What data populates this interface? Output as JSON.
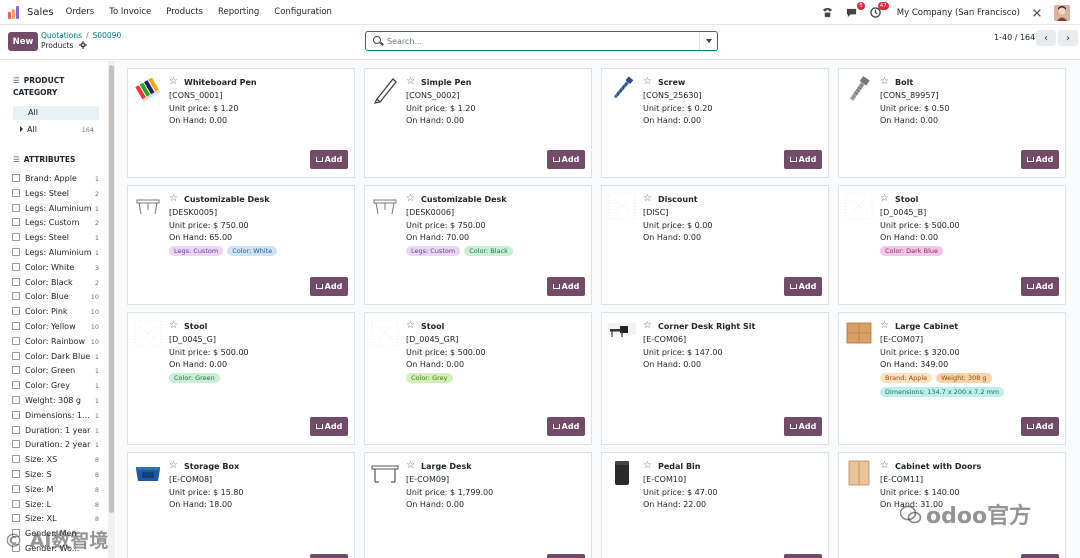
{
  "navbar": {
    "app_name": "Sales",
    "menu": [
      "Orders",
      "To Invoice",
      "Products",
      "Reporting",
      "Configuration"
    ],
    "chat_badge": "5",
    "activity_badge": "47",
    "company": "My Company (San Francisco)"
  },
  "control": {
    "new_label": "New",
    "breadcrumb_parent": "Quotations",
    "breadcrumb_sep": "/",
    "breadcrumb_record": "S00090",
    "breadcrumb_current": "Products",
    "search_placeholder": "Search...",
    "pager": "1-40 / 164",
    "prev_icon": "‹",
    "next_icon": "›"
  },
  "sidebar": {
    "category_title_1": "PRODUCT",
    "category_title_2": "CATEGORY",
    "category_selected": "All",
    "category_row": {
      "label": "All",
      "count": "164"
    },
    "attributes_title": "ATTRIBUTES",
    "attributes": [
      {
        "label": "Brand: Apple",
        "count": "1"
      },
      {
        "label": "Legs: Steel",
        "count": "2"
      },
      {
        "label": "Legs: Aluminium",
        "count": "1"
      },
      {
        "label": "Legs: Custom",
        "count": "2"
      },
      {
        "label": "Legs: Steel",
        "count": "1"
      },
      {
        "label": "Legs: Aluminium",
        "count": "1"
      },
      {
        "label": "Color: White",
        "count": "3"
      },
      {
        "label": "Color: Black",
        "count": "2"
      },
      {
        "label": "Color: Blue",
        "count": "10"
      },
      {
        "label": "Color: Pink",
        "count": "10"
      },
      {
        "label": "Color: Yellow",
        "count": "10"
      },
      {
        "label": "Color: Rainbow",
        "count": "10"
      },
      {
        "label": "Color: Dark Blue",
        "count": "1"
      },
      {
        "label": "Color: Green",
        "count": "1"
      },
      {
        "label": "Color: Grey",
        "count": "1"
      },
      {
        "label": "Weight: 308 g",
        "count": "1"
      },
      {
        "label": "Dimensions: 1...",
        "count": "1"
      },
      {
        "label": "Duration: 1 year",
        "count": "1"
      },
      {
        "label": "Duration: 2 year",
        "count": "1"
      },
      {
        "label": "Size: XS",
        "count": "8"
      },
      {
        "label": "Size: S",
        "count": "8"
      },
      {
        "label": "Size: M",
        "count": "8"
      },
      {
        "label": "Size: L",
        "count": "8"
      },
      {
        "label": "Size: XL",
        "count": "8"
      },
      {
        "label": "Gender: Men",
        "count": ""
      },
      {
        "label": "Gender: Wo...",
        "count": ""
      }
    ]
  },
  "add_label": "Add",
  "products": [
    {
      "name": "Whiteboard Pen",
      "ref": "[CONS_0001]",
      "price": "Unit price: $ 1.20",
      "onhand": "On Hand: 0.00",
      "tags": []
    },
    {
      "name": "Simple Pen",
      "ref": "[CONS_0002]",
      "price": "Unit price: $ 1.20",
      "onhand": "On Hand: 0.00",
      "tags": []
    },
    {
      "name": "Screw",
      "ref": "[CONS_25630]",
      "price": "Unit price: $ 0.20",
      "onhand": "On Hand: 0.00",
      "tags": []
    },
    {
      "name": "Bolt",
      "ref": "[CONS_89957]",
      "price": "Unit price: $ 0.50",
      "onhand": "On Hand: 0.00",
      "tags": []
    },
    {
      "name": "Customizable Desk",
      "ref": "[DESK0005]",
      "price": "Unit price: $ 750.00",
      "onhand": "On Hand: 65.00",
      "tags": [
        {
          "label": "Legs: Custom",
          "bg": "#e9d6f5",
          "fg": "#6b3a8a"
        },
        {
          "label": "Color: White",
          "bg": "#cfe3f7",
          "fg": "#2a5d8f"
        }
      ]
    },
    {
      "name": "Customizable Desk",
      "ref": "[DESK0006]",
      "price": "Unit price: $ 750.00",
      "onhand": "On Hand: 70.00",
      "tags": [
        {
          "label": "Legs: Custom",
          "bg": "#e9d6f5",
          "fg": "#6b3a8a"
        },
        {
          "label": "Color: Black",
          "bg": "#c9f0d6",
          "fg": "#24704a"
        }
      ]
    },
    {
      "name": "Discount",
      "ref": "[DISC]",
      "price": "Unit price: $ 0.00",
      "onhand": "On Hand: 0.00",
      "tags": []
    },
    {
      "name": "Stool",
      "ref": "[D_0045_B]",
      "price": "Unit price: $ 500.00",
      "onhand": "On Hand: 0.00",
      "tags": [
        {
          "label": "Color: Dark Blue",
          "bg": "#f1c6e6",
          "fg": "#7a2f66"
        }
      ]
    },
    {
      "name": "Stool",
      "ref": "[D_0045_G]",
      "price": "Unit price: $ 500.00",
      "onhand": "On Hand: 0.00",
      "tags": [
        {
          "label": "Color: Green",
          "bg": "#c9f0d6",
          "fg": "#24704a"
        }
      ]
    },
    {
      "name": "Stool",
      "ref": "[D_0045_GR]",
      "price": "Unit price: $ 500.00",
      "onhand": "On Hand: 0.00",
      "tags": [
        {
          "label": "Color: Grey",
          "bg": "#d4f0b8",
          "fg": "#4c7a1e"
        }
      ]
    },
    {
      "name": "Corner Desk Right Sit",
      "ref": "[E-COM06]",
      "price": "Unit price: $ 147.00",
      "onhand": "On Hand: 0.00",
      "tags": []
    },
    {
      "name": "Large Cabinet",
      "ref": "[E-COM07]",
      "price": "Unit price: $ 320.00",
      "onhand": "On Hand: 349.00",
      "tags": [
        {
          "label": "Brand: Apple",
          "bg": "#fde0c2",
          "fg": "#8a4f12"
        },
        {
          "label": "Weight: 308 g",
          "bg": "#fbd3a8",
          "fg": "#8a4f12"
        },
        {
          "label": "Dimensions: 134.7 x 200 x 7.2 mm",
          "bg": "#bff0e8",
          "fg": "#1c6b60"
        }
      ]
    },
    {
      "name": "Storage Box",
      "ref": "[E-COM08]",
      "price": "Unit price: $ 15.80",
      "onhand": "On Hand: 18.00",
      "tags": []
    },
    {
      "name": "Large Desk",
      "ref": "[E-COM09]",
      "price": "Unit price: $ 1,799.00",
      "onhand": "On Hand: 0.00",
      "tags": []
    },
    {
      "name": "Pedal Bin",
      "ref": "[E-COM10]",
      "price": "Unit price: $ 47.00",
      "onhand": "On Hand: 22.00",
      "tags": []
    },
    {
      "name": "Cabinet with Doors",
      "ref": "[E-COM11]",
      "price": "Unit price: $ 140.00",
      "onhand": "On Hand: 31.00",
      "tags": []
    }
  ],
  "watermarks": {
    "left": "© AI数智境",
    "right": "odoo官方"
  }
}
